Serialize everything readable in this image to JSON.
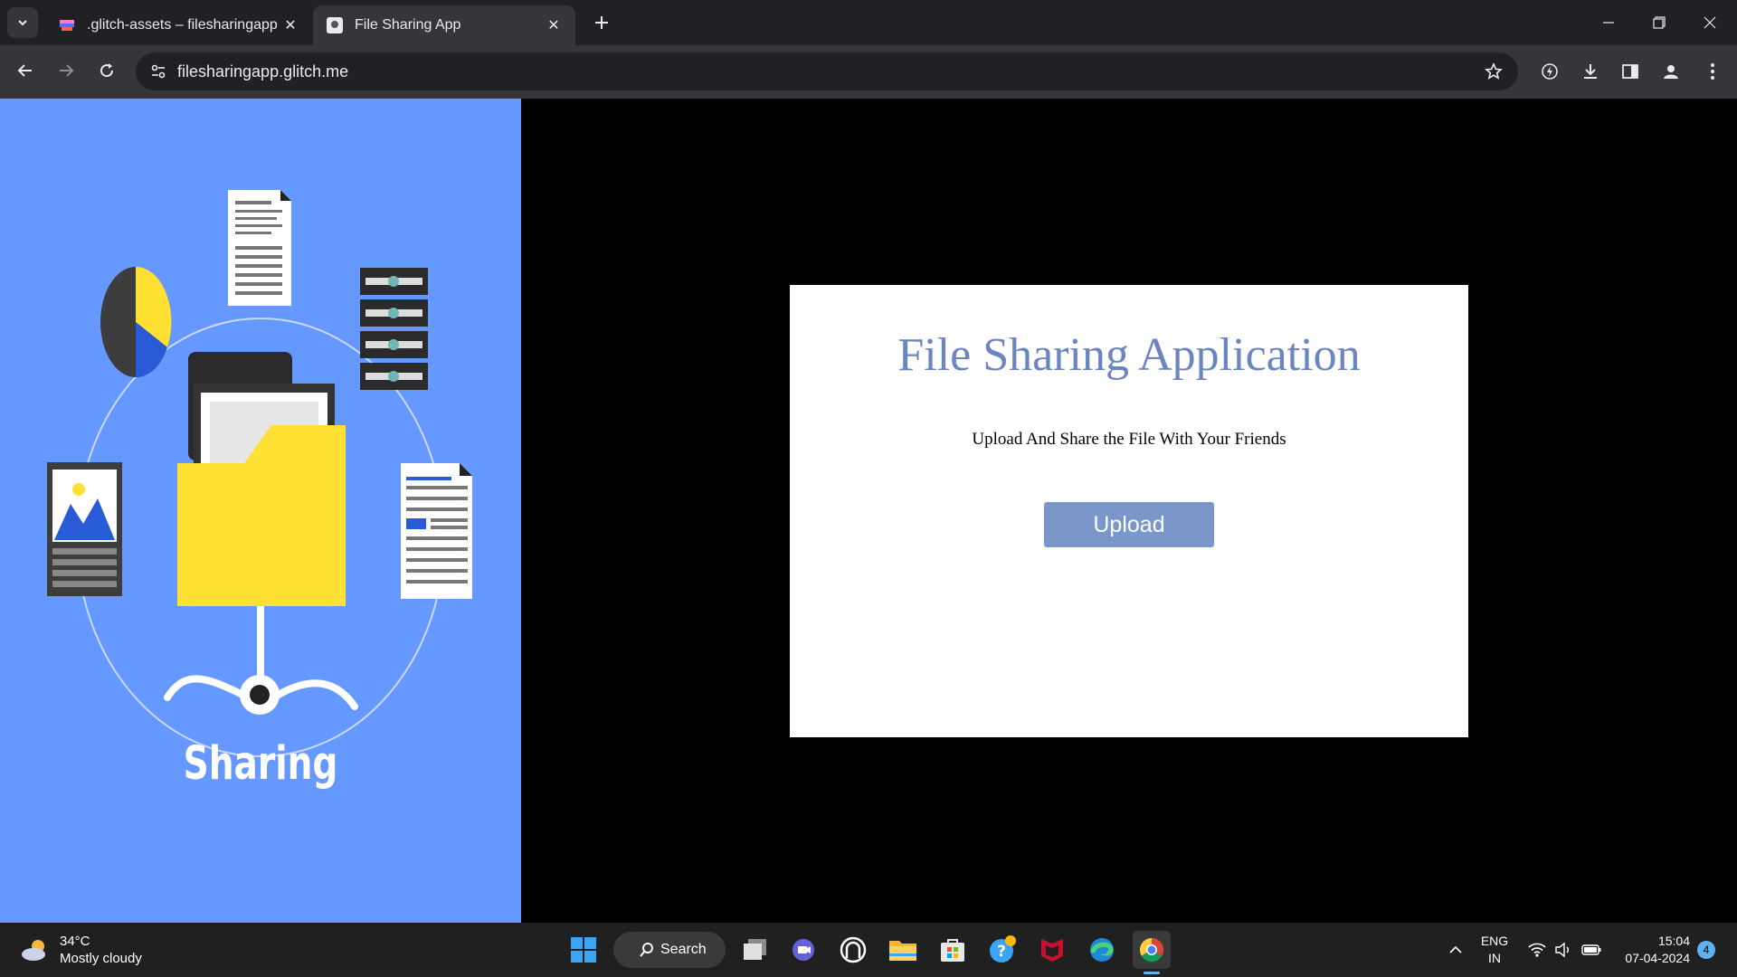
{
  "browser": {
    "tabs": [
      {
        "title": ".glitch-assets – filesharingapp",
        "active": false
      },
      {
        "title": "File Sharing App",
        "active": true
      }
    ],
    "url": "filesharingapp.glitch.me"
  },
  "hero": {
    "caption": "Sharing",
    "colors": {
      "background": "#6699ff",
      "folder": "#ffe033"
    }
  },
  "card": {
    "title": "File Sharing Application",
    "subtitle": "Upload And Share the File With Your Friends",
    "upload_label": "Upload",
    "colors": {
      "title": "#6b85c2",
      "button": "#7b96c9"
    }
  },
  "taskbar": {
    "weather": {
      "temp": "34°C",
      "condition": "Mostly cloudy"
    },
    "search_label": "Search",
    "apps": [
      "start-icon",
      "task-view-icon",
      "meet-icon",
      "app-icon",
      "file-explorer-icon",
      "store-icon",
      "help-icon",
      "mcafee-icon",
      "edge-icon",
      "chrome-icon"
    ],
    "lang": {
      "line1": "ENG",
      "line2": "IN"
    },
    "time": "15:04",
    "date": "07-04-2024",
    "notifications": "4"
  }
}
